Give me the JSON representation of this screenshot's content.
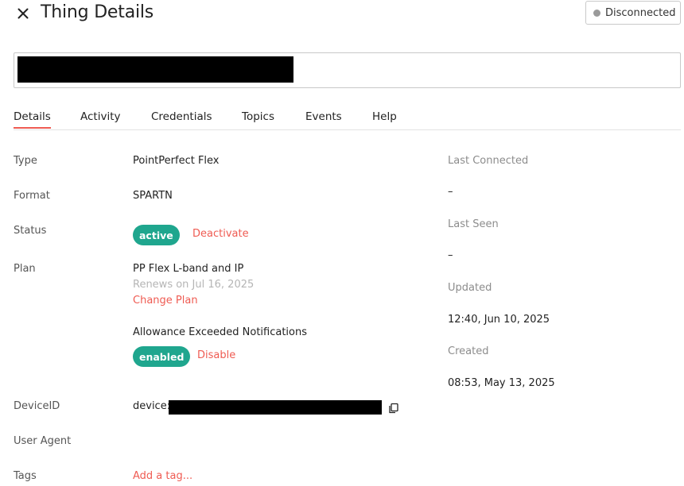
{
  "header": {
    "title": "Thing Details",
    "connection_status": "Disconnected"
  },
  "tabs": [
    {
      "label": "Details",
      "active": true
    },
    {
      "label": "Activity"
    },
    {
      "label": "Credentials"
    },
    {
      "label": "Topics"
    },
    {
      "label": "Events"
    },
    {
      "label": "Help"
    }
  ],
  "details": {
    "type_label": "Type",
    "type_value": "PointPerfect Flex",
    "format_label": "Format",
    "format_value": "SPARTN",
    "status_label": "Status",
    "status_badge": "active",
    "deactivate_link": "Deactivate",
    "plan_label": "Plan",
    "plan_name": "PP Flex L-band and IP",
    "plan_renews": "Renews on Jul 16, 2025",
    "change_plan_link": "Change Plan",
    "allowance_label": "Allowance Exceeded Notifications",
    "allowance_badge": "enabled",
    "disable_link": "Disable",
    "deviceid_label": "DeviceID",
    "deviceid_prefix": "device:",
    "user_agent_label": "User Agent",
    "tags_label": "Tags",
    "add_tag_link": "Add a tag..."
  },
  "sidebar": {
    "last_connected_label": "Last Connected",
    "last_connected_value": "–",
    "last_seen_label": "Last Seen",
    "last_seen_value": "–",
    "updated_label": "Updated",
    "updated_value": "12:40, Jun 10, 2025",
    "created_label": "Created",
    "created_value": "08:53, May 13, 2025"
  },
  "colors": {
    "accent": "#ef5b52",
    "badge": "#1fa68e",
    "status_dot": "#9a9a9a"
  },
  "icons": {
    "close": "close-icon",
    "status_dot": "status-dot-icon",
    "copy": "copy-icon"
  }
}
